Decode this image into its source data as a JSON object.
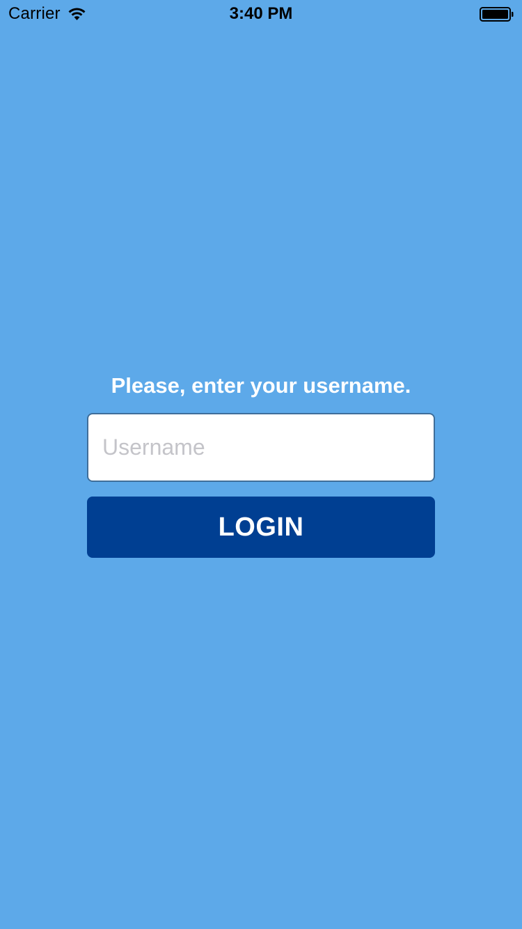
{
  "status_bar": {
    "carrier": "Carrier",
    "time": "3:40 PM",
    "wifi_icon": "wifi-icon",
    "battery_icon": "battery-full-icon"
  },
  "login": {
    "prompt": "Please, enter your username.",
    "username_value": "",
    "username_placeholder": "Username",
    "login_label": "LOGIN"
  },
  "colors": {
    "background": "#5DA9E9",
    "button": "#003F92",
    "input_border": "#3F6E9A",
    "text_light": "#FFFFFF"
  }
}
